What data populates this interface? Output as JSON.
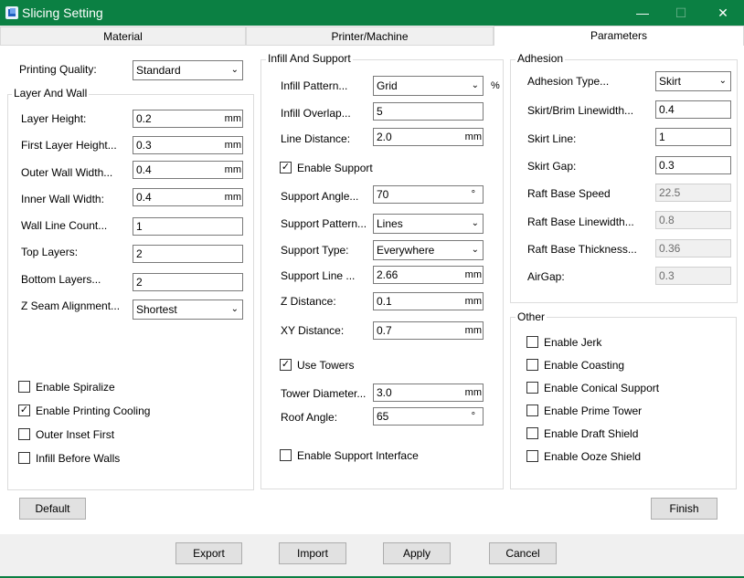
{
  "window": {
    "title": "Slicing Setting",
    "minimize_glyph": "—",
    "maximize_glyph": "☐",
    "close_glyph": "✕",
    "accent_color": "#0b8043"
  },
  "tabs": [
    {
      "label": "Material"
    },
    {
      "label": "Printer/Machine"
    },
    {
      "label": "Parameters",
      "active": true
    }
  ],
  "quality": {
    "label": "Printing Quality:",
    "value": "Standard"
  },
  "layer_wall": {
    "title": "Layer And Wall",
    "layer_height": {
      "label": "Layer Height:",
      "value": "0.2",
      "unit": "mm"
    },
    "first_layer_height": {
      "label": "First Layer Height...",
      "value": "0.3",
      "unit": "mm"
    },
    "outer_wall_width": {
      "label": "Outer Wall Width...",
      "value": "0.4",
      "unit": "mm"
    },
    "inner_wall_width": {
      "label": "Inner Wall Width:",
      "value": "0.4",
      "unit": "mm"
    },
    "wall_line_count": {
      "label": "Wall Line Count...",
      "value": "1"
    },
    "top_layers": {
      "label": "Top Layers:",
      "value": "2"
    },
    "bottom_layers": {
      "label": "Bottom Layers...",
      "value": "2"
    },
    "z_seam": {
      "label": "Z Seam Alignment...",
      "value": "Shortest"
    },
    "checks": [
      {
        "label": "Enable Spiralize",
        "checked": false
      },
      {
        "label": "Enable Printing Cooling",
        "checked": true
      },
      {
        "label": "Outer Inset First",
        "checked": false
      },
      {
        "label": "Infill Before Walls",
        "checked": false
      }
    ]
  },
  "infill_support": {
    "title": "Infill And Support",
    "infill_pattern": {
      "label": "Infill Pattern...",
      "value": "Grid",
      "unit": "%"
    },
    "infill_overlap": {
      "label": "Infill Overlap...",
      "value": "5"
    },
    "line_distance": {
      "label": "Line Distance:",
      "value": "2.0",
      "unit": "mm"
    },
    "enable_support": {
      "label": "Enable Support",
      "checked": true
    },
    "support_angle": {
      "label": "Support Angle...",
      "value": "70",
      "unit": "°"
    },
    "support_pattern": {
      "label": "Support Pattern...",
      "value": "Lines"
    },
    "support_type": {
      "label": "Support Type:",
      "value": "Everywhere"
    },
    "support_line": {
      "label": "Support Line ...",
      "value": "2.66",
      "unit": "mm"
    },
    "z_distance": {
      "label": "Z Distance:",
      "value": "0.1",
      "unit": "mm"
    },
    "xy_distance": {
      "label": "XY Distance:",
      "value": "0.7",
      "unit": "mm"
    },
    "use_towers": {
      "label": "Use Towers",
      "checked": true
    },
    "tower_diameter": {
      "label": "Tower Diameter...",
      "value": "3.0",
      "unit": "mm"
    },
    "roof_angle": {
      "label": "Roof Angle:",
      "value": "65",
      "unit": "°"
    },
    "support_interface": {
      "label": "Enable Support Interface",
      "checked": false
    }
  },
  "adhesion": {
    "title": "Adhesion",
    "adhesion_type": {
      "label": "Adhesion Type...",
      "value": "Skirt"
    },
    "brim_linewidth": {
      "label": "Skirt/Brim Linewidth...",
      "value": "0.4"
    },
    "skirt_line": {
      "label": "Skirt Line:",
      "value": "1"
    },
    "skirt_gap": {
      "label": "Skirt Gap:",
      "value": "0.3"
    },
    "raft_base_speed": {
      "label": "Raft Base Speed",
      "value": "22.5"
    },
    "raft_base_linewidth": {
      "label": "Raft Base Linewidth...",
      "value": "0.8"
    },
    "raft_base_thickness": {
      "label": "Raft Base Thickness...",
      "value": "0.36"
    },
    "airgap": {
      "label": "AirGap:",
      "value": "0.3"
    }
  },
  "other": {
    "title": "Other",
    "checks": [
      {
        "label": "Enable Jerk",
        "checked": false
      },
      {
        "label": "Enable Coasting",
        "checked": false
      },
      {
        "label": "Enable Conical Support",
        "checked": false
      },
      {
        "label": "Enable Prime Tower",
        "checked": false
      },
      {
        "label": "Enable Draft Shield",
        "checked": false
      },
      {
        "label": "Enable Ooze Shield",
        "checked": false
      }
    ]
  },
  "buttons": {
    "default": "Default",
    "finish": "Finish",
    "export": "Export",
    "import": "Import",
    "apply": "Apply",
    "cancel": "Cancel"
  },
  "icons": {
    "checkmark": "✓",
    "chevron": "⌵"
  }
}
